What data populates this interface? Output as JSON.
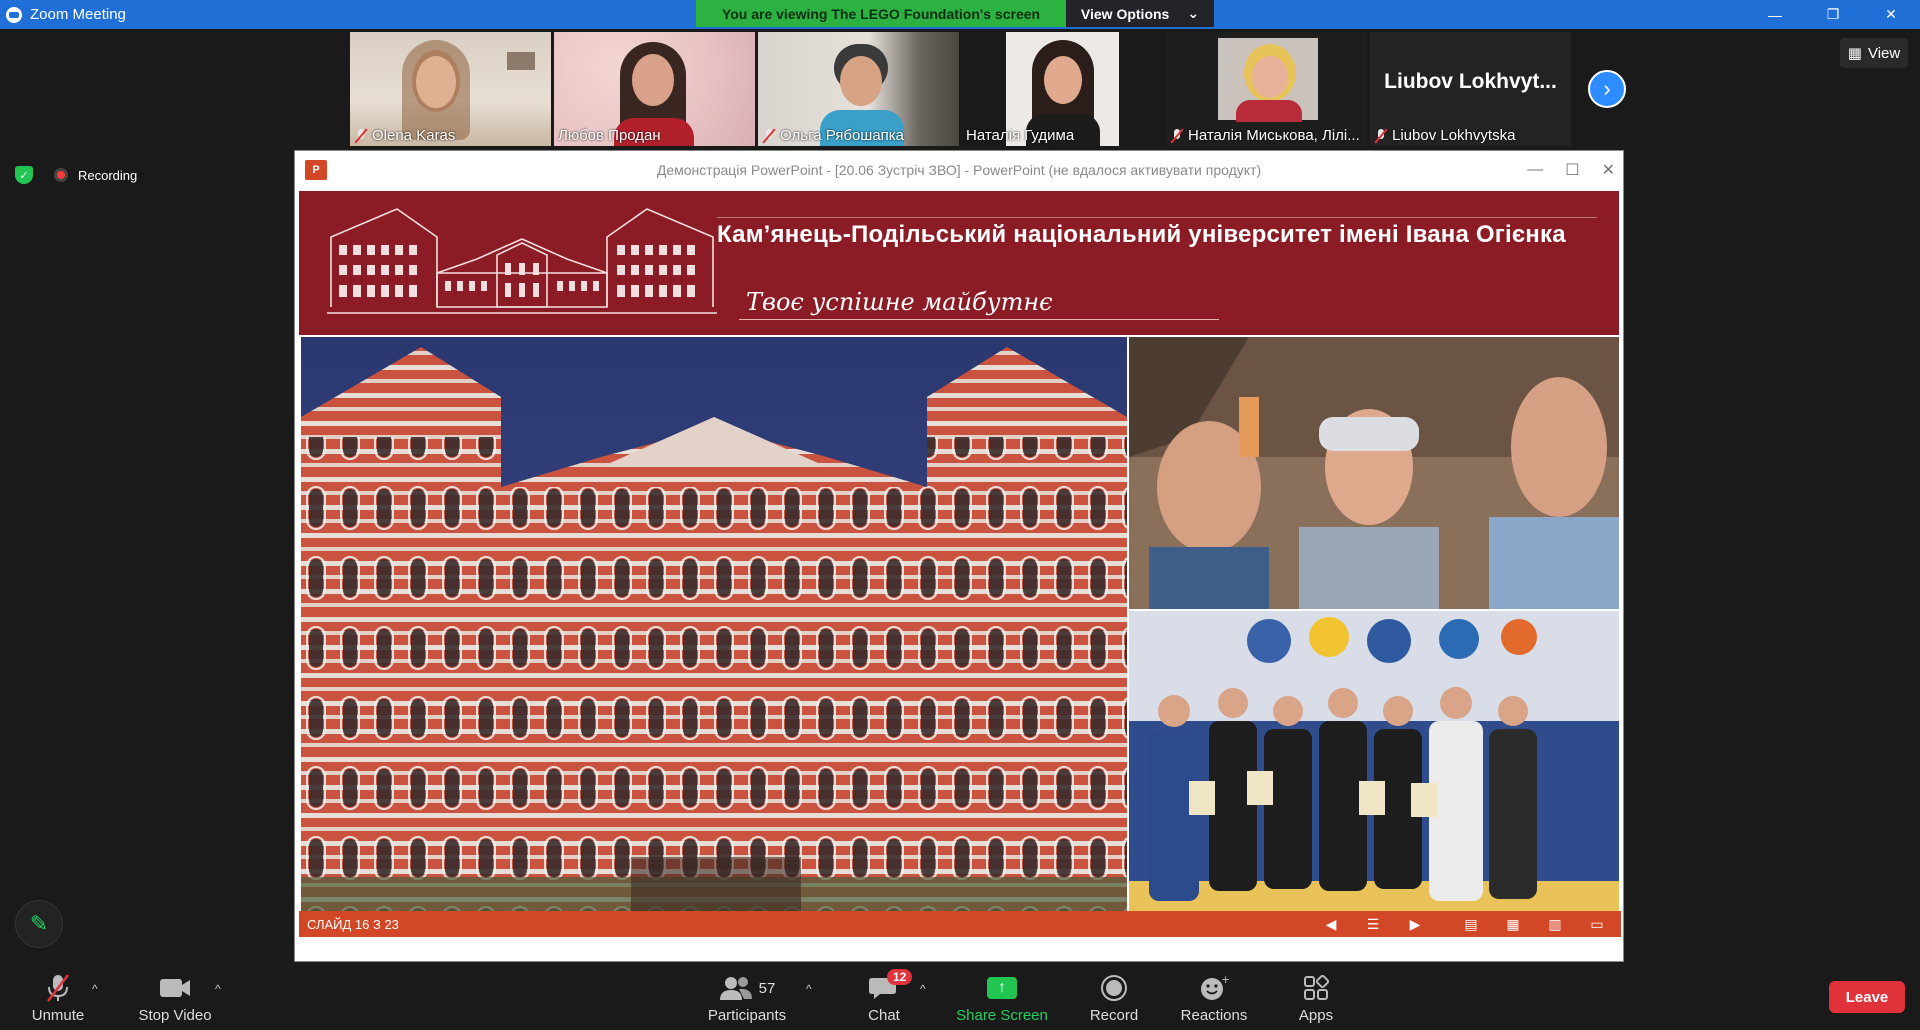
{
  "window": {
    "title": "Zoom Meeting",
    "controls": [
      "—",
      "❐",
      "✕"
    ]
  },
  "banner": {
    "message": "You are viewing The LEGO Foundation's screen",
    "view_options": "View Options"
  },
  "gallery": {
    "participants": [
      {
        "name": "Olena Karas",
        "muted": true
      },
      {
        "name": "Любов Продан",
        "muted": false
      },
      {
        "name": "Ольга Рябошапка",
        "muted": true
      },
      {
        "name": "Наталія Гудима",
        "muted": false,
        "active": true
      },
      {
        "name": "Наталія Миськова, Лілі...",
        "muted": true
      },
      {
        "name": "Liubov Lokhvytska",
        "muted": true,
        "big_name": "Liubov  Lokhvyt..."
      }
    ],
    "view_label": "View"
  },
  "recording": {
    "label": "Recording"
  },
  "share": {
    "title": "Демонстрація PowerPoint - [20.06 Зустріч ЗВО] - PowerPoint (не вдалося активувати продукт)",
    "app_icon_text": "P",
    "slide": {
      "university": "Кам’янець-Подільський національний університет імені Івана Огієнка",
      "motto": "Твоє успішне майбутнє",
      "counter": "СЛАЙД 16 З 23"
    }
  },
  "toolbar": {
    "unmute": "Unmute",
    "stop_video": "Stop Video",
    "participants": "Participants",
    "participants_count": "57",
    "chat": "Chat",
    "chat_badge": "12",
    "share_screen": "Share Screen",
    "record": "Record",
    "reactions": "Reactions",
    "apps": "Apps",
    "leave": "Leave"
  },
  "colors": {
    "title_bar": "#1f6fd6",
    "banner_green": "#2bb240",
    "ppt_red": "#d24726",
    "slide_banner": "#8b1c25",
    "leave_red": "#e0323a"
  }
}
